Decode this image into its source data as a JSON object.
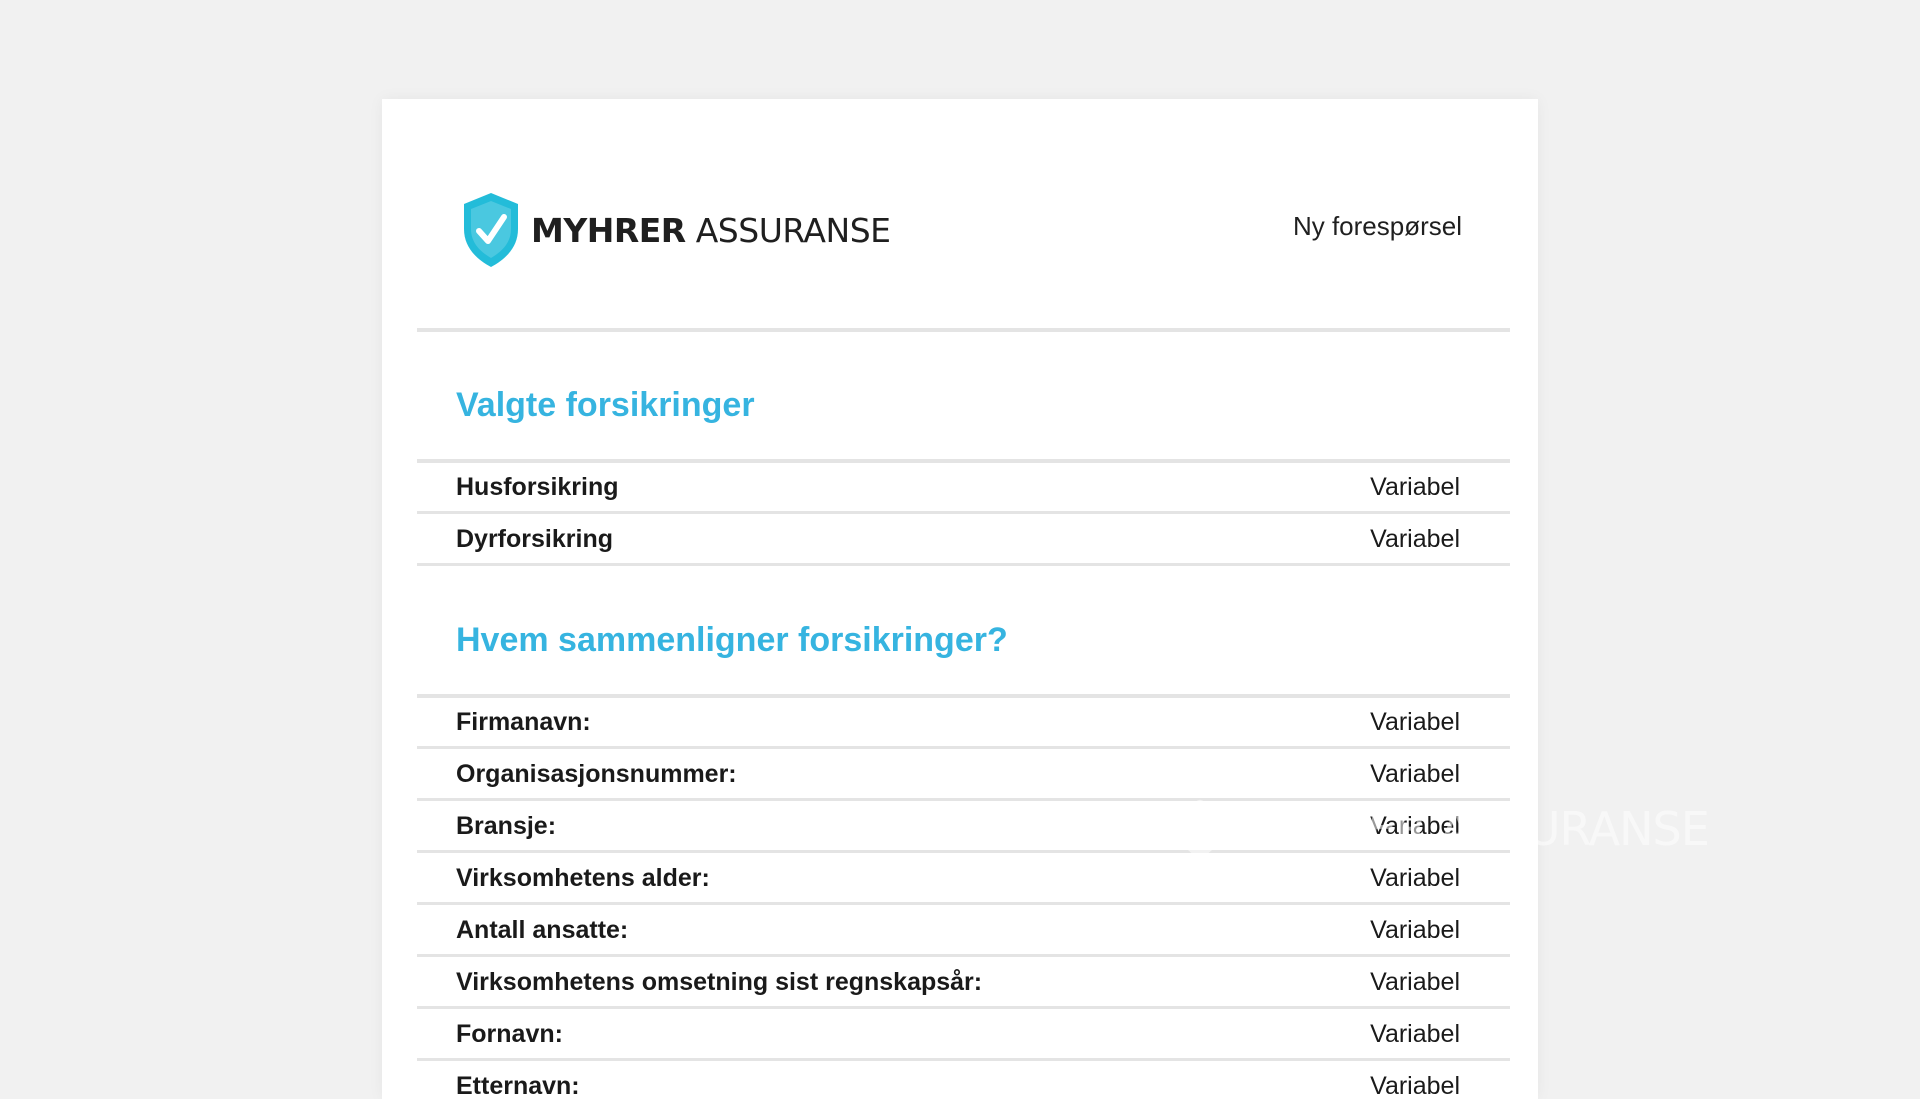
{
  "logo": {
    "brand_bold": "MYHRER",
    "brand_regular": "ASSURANSE",
    "icon": "shield-check-icon",
    "color": "#23bcd9"
  },
  "header": {
    "title": "Ny forespørsel"
  },
  "sections": [
    {
      "title": "Valgte forsikringer",
      "rows": [
        {
          "label": "Husforsikring",
          "value": "Variabel"
        },
        {
          "label": "Dyrforsikring",
          "value": "Variabel"
        }
      ]
    },
    {
      "title": "Hvem sammenligner forsikringer?",
      "rows": [
        {
          "label": "Firmanavn:",
          "value": "Variabel"
        },
        {
          "label": "Organisasjonsnummer:",
          "value": "Variabel"
        },
        {
          "label": "Bransje:",
          "value": "Variabel"
        },
        {
          "label": "Virksomhetens alder:",
          "value": "Variabel"
        },
        {
          "label": "Antall ansatte:",
          "value": "Variabel"
        },
        {
          "label": "Virksomhetens omsetning sist regnskapsår:",
          "value": "Variabel"
        },
        {
          "label": "Fornavn:",
          "value": "Variabel"
        },
        {
          "label": "Etternavn:",
          "value": "Variabel"
        }
      ]
    }
  ],
  "watermark": {
    "text": "MYHRER ASSURANSE"
  },
  "colors": {
    "accent": "#36b4e0",
    "background": "#f1f1f1",
    "divider": "#e4e4e4"
  }
}
